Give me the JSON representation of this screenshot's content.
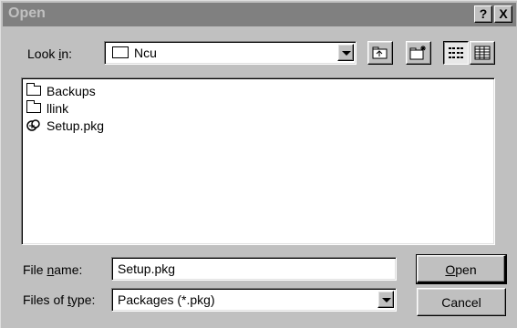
{
  "window": {
    "title": "Open",
    "help_glyph": "?",
    "close_glyph": "X"
  },
  "look_in": {
    "label_pre": "Look ",
    "label_key": "i",
    "label_post": "n:",
    "value": "Ncu"
  },
  "files": [
    {
      "name": "Backups",
      "icon": "folder-icon"
    },
    {
      "name": "llink",
      "icon": "folder-icon"
    },
    {
      "name": "Setup.pkg",
      "icon": "package-icon"
    }
  ],
  "file_name": {
    "label_pre": "File ",
    "label_key": "n",
    "label_post": "ame:",
    "value": "Setup.pkg"
  },
  "files_of_type": {
    "label_pre": "Files of ",
    "label_key": "t",
    "label_post": "ype:",
    "value": "Packages (*.pkg)"
  },
  "buttons": {
    "open_key": "O",
    "open_rest": "pen",
    "cancel": "Cancel"
  }
}
